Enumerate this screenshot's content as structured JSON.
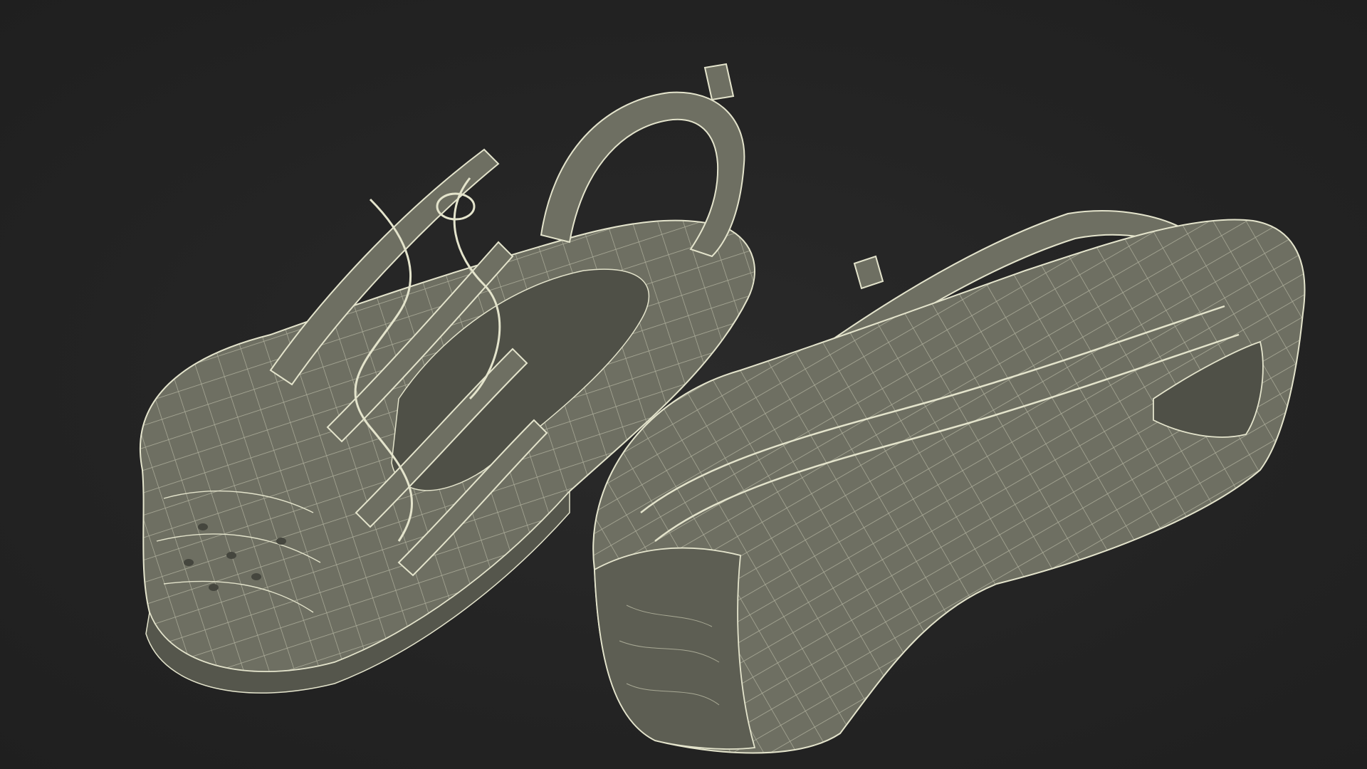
{
  "scene": {
    "background_color": "#232323",
    "model_fill_color": "#6e6f62",
    "model_shadow_color": "#4f5047",
    "wire_color": "#e4e4cc",
    "objects": [
      {
        "name": "left-sandal",
        "view": "top"
      },
      {
        "name": "right-sandal",
        "view": "sole"
      }
    ]
  }
}
